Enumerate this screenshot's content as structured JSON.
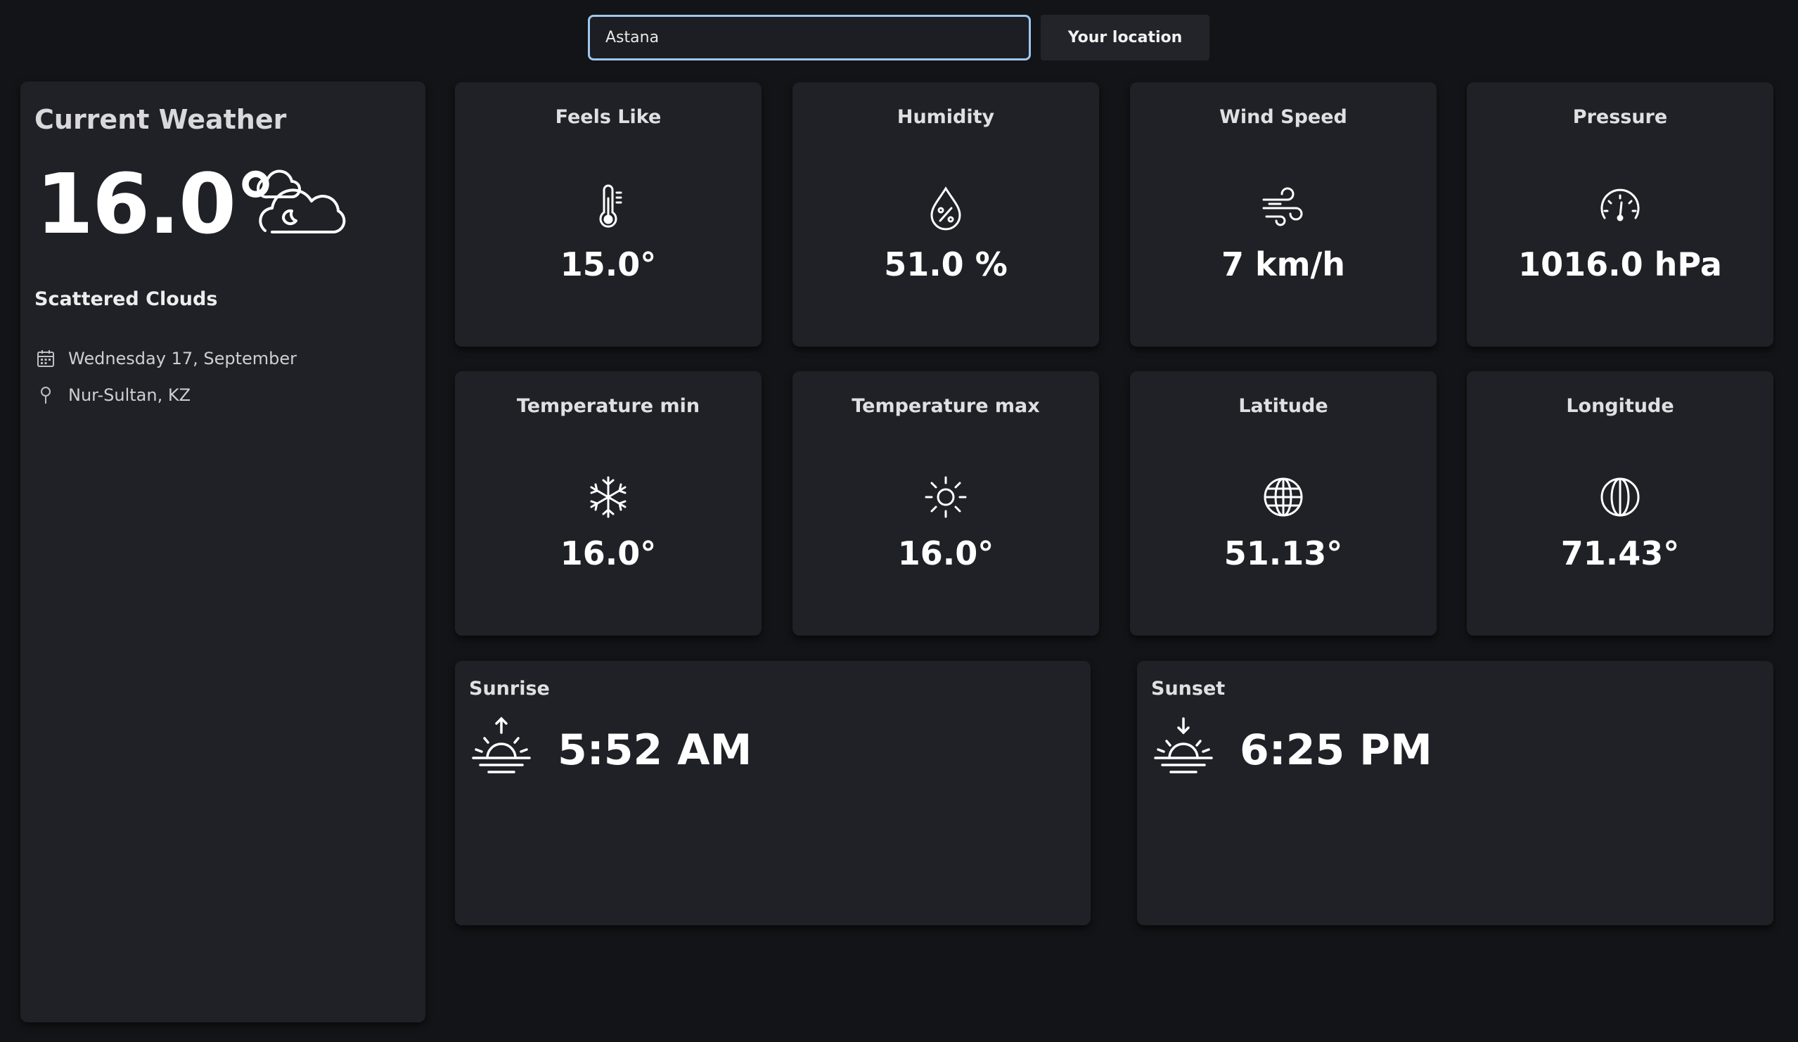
{
  "search": {
    "value": "Astana",
    "location_button": "Your location"
  },
  "current": {
    "title": "Current Weather",
    "temperature": "16.0°",
    "condition": "Scattered Clouds",
    "date": "Wednesday 17, September",
    "location": "Nur-Sultan, KZ",
    "icon": "partly-cloudy-night-icon"
  },
  "cards": [
    {
      "title": "Feels Like",
      "value": "15.0°",
      "icon": "thermometer-icon"
    },
    {
      "title": "Humidity",
      "value": "51.0 %",
      "icon": "humidity-drop-icon"
    },
    {
      "title": "Wind Speed",
      "value": "7 km/h",
      "icon": "wind-icon"
    },
    {
      "title": "Pressure",
      "value": "1016.0 hPa",
      "icon": "gauge-icon"
    },
    {
      "title": "Temperature min",
      "value": "16.0°",
      "icon": "snowflake-icon"
    },
    {
      "title": "Temperature max",
      "value": "16.0°",
      "icon": "sun-icon"
    },
    {
      "title": "Latitude",
      "value": "51.13°",
      "icon": "globe-icon"
    },
    {
      "title": "Longitude",
      "value": "71.43°",
      "icon": "longitude-globe-icon"
    }
  ],
  "sunrise": {
    "title": "Sunrise",
    "time": "5:52 AM",
    "icon": "sunrise-icon"
  },
  "sunset": {
    "title": "Sunset",
    "time": "6:25 PM",
    "icon": "sunset-icon"
  },
  "colors": {
    "background": "#131417",
    "card": "#202126",
    "search_border": "#9ec7ee",
    "text": "#ffffff"
  }
}
